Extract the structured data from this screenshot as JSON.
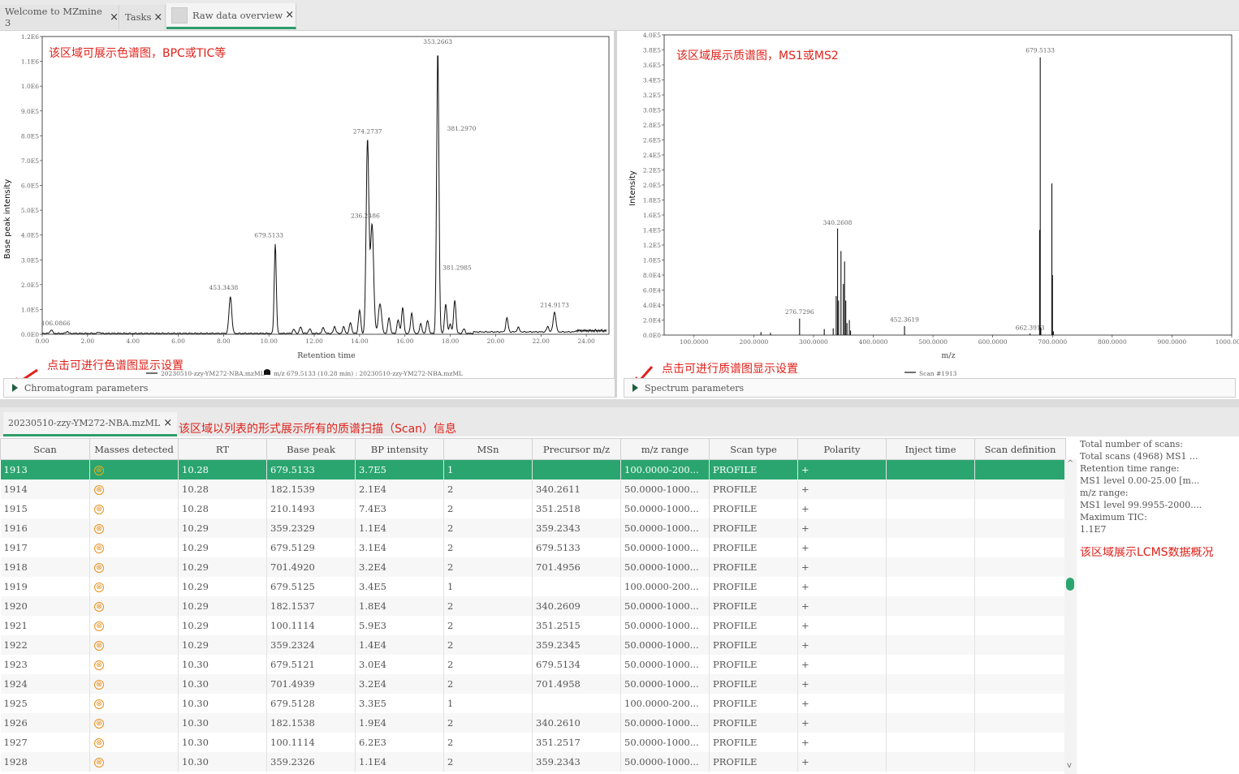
{
  "tabs": [
    {
      "label": "Welcome to MZmine 3",
      "close": "×"
    },
    {
      "label": "Tasks",
      "close": "×"
    },
    {
      "label": "Raw data overview",
      "close": "×"
    }
  ],
  "chromatogram": {
    "annotation": "该区域可展示色谱图，BPC或TIC等",
    "settings_annotation": "点击可进行色谱图显示设置",
    "ylabel": "Base peak intensity",
    "xlabel": "Retention time",
    "legend": "20230510-zzy-YM272-NBA.mzML",
    "legend_marker_text": "m/z 679.5133 (10.28 min) : 20230510-zzy-YM272-NBA.mzML",
    "params_label": "Chromatogram parameters",
    "xticks": [
      "0.00",
      "2.00",
      "4.00",
      "6.00",
      "8.00",
      "10.00",
      "12.00",
      "14.00",
      "16.00",
      "18.00",
      "20.00",
      "22.00",
      "24.00"
    ],
    "yticks": [
      "0.0E0",
      "1.0E5",
      "2.0E5",
      "3.0E5",
      "4.0E5",
      "5.0E5",
      "6.0E5",
      "7.0E5",
      "8.0E5",
      "9.0E5",
      "1.0E6",
      "1.1E6",
      "1.2E6"
    ],
    "peak_labels": [
      "106.0866",
      "453.3438",
      "679.5133",
      "274.2737",
      "236.2486",
      "353.2663",
      "381.2970",
      "381.2985",
      "214.9173"
    ]
  },
  "spectrum": {
    "annotation": "该区域展示质谱图，MS1或MS2",
    "settings_annotation": "点击可进行质谱图显示设置",
    "ylabel": "Intensity",
    "xlabel": "m/z",
    "legend": "Scan #1913",
    "params_label": "Spectrum parameters",
    "xticks": [
      "100.0000",
      "200.0000",
      "300.0000",
      "400.0000",
      "500.0000",
      "600.0000",
      "700.0000",
      "800.0000",
      "900.0000",
      "1000.0000"
    ],
    "yticks": [
      "0.0E0",
      "2.0E4",
      "4.0E4",
      "6.0E4",
      "8.0E4",
      "1.0E5",
      "1.2E5",
      "1.4E5",
      "1.6E5",
      "1.8E5",
      "2.0E5",
      "2.2E5",
      "2.4E5",
      "2.6E5",
      "2.8E5",
      "3.0E5",
      "3.2E5",
      "3.4E5",
      "3.6E5",
      "3.8E5",
      "4.0E5"
    ],
    "peak_labels": [
      "679.5133",
      "340.2608",
      "276.7296",
      "452.3619",
      "662.3913"
    ]
  },
  "file_tab": {
    "label": "20230510-zzy-YM272-NBA.mzML",
    "close": "×"
  },
  "table_annotation": "该区域以列表的形式展示所有的质谱扫描（Scan）信息",
  "table": {
    "headers": [
      "Scan",
      "Masses detected",
      "RT",
      "Base peak",
      "BP intensity",
      "MSn",
      "Precursor m/z",
      "m/z range",
      "Scan type",
      "Polarity",
      "Inject time",
      "Scan definition"
    ],
    "masses_icon": "⊗",
    "rows": [
      [
        "1913",
        "10.28",
        "679.5133",
        "3.7E5",
        "1",
        "",
        "100.0000-200...",
        "PROFILE",
        "+"
      ],
      [
        "1914",
        "10.28",
        "182.1539",
        "2.1E4",
        "2",
        "340.2611",
        "50.0000-1000...",
        "PROFILE",
        "+"
      ],
      [
        "1915",
        "10.28",
        "210.1493",
        "7.4E3",
        "2",
        "351.2518",
        "50.0000-1000...",
        "PROFILE",
        "+"
      ],
      [
        "1916",
        "10.29",
        "359.2329",
        "1.1E4",
        "2",
        "359.2343",
        "50.0000-1000...",
        "PROFILE",
        "+"
      ],
      [
        "1917",
        "10.29",
        "679.5129",
        "3.1E4",
        "2",
        "679.5133",
        "50.0000-1000...",
        "PROFILE",
        "+"
      ],
      [
        "1918",
        "10.29",
        "701.4920",
        "3.2E4",
        "2",
        "701.4956",
        "50.0000-1000...",
        "PROFILE",
        "+"
      ],
      [
        "1919",
        "10.29",
        "679.5125",
        "3.4E5",
        "1",
        "",
        "100.0000-200...",
        "PROFILE",
        "+"
      ],
      [
        "1920",
        "10.29",
        "182.1537",
        "1.8E4",
        "2",
        "340.2609",
        "50.0000-1000...",
        "PROFILE",
        "+"
      ],
      [
        "1921",
        "10.29",
        "100.1114",
        "5.9E3",
        "2",
        "351.2515",
        "50.0000-1000...",
        "PROFILE",
        "+"
      ],
      [
        "1922",
        "10.29",
        "359.2324",
        "1.4E4",
        "2",
        "359.2345",
        "50.0000-1000...",
        "PROFILE",
        "+"
      ],
      [
        "1923",
        "10.30",
        "679.5121",
        "3.0E4",
        "2",
        "679.5134",
        "50.0000-1000...",
        "PROFILE",
        "+"
      ],
      [
        "1924",
        "10.30",
        "701.4939",
        "3.2E4",
        "2",
        "701.4958",
        "50.0000-1000...",
        "PROFILE",
        "+"
      ],
      [
        "1925",
        "10.30",
        "679.5128",
        "3.3E5",
        "1",
        "",
        "100.0000-200...",
        "PROFILE",
        "+"
      ],
      [
        "1926",
        "10.30",
        "182.1538",
        "1.9E4",
        "2",
        "340.2610",
        "50.0000-1000...",
        "PROFILE",
        "+"
      ],
      [
        "1927",
        "10.30",
        "100.1114",
        "6.2E3",
        "2",
        "351.2517",
        "50.0000-1000...",
        "PROFILE",
        "+"
      ],
      [
        "1928",
        "10.30",
        "359.2326",
        "1.1E4",
        "2",
        "359.2343",
        "50.0000-1000...",
        "PROFILE",
        "+"
      ]
    ]
  },
  "summary": {
    "lines": [
      "Total number of scans:",
      "Total scans (4968) MS1 ...",
      "Retention time range:",
      "MS1 level 0.00-25.00 [m...",
      "m/z range:",
      "MS1 level 99.9955-2000....",
      "Maximum TIC:",
      "1.1E7"
    ],
    "annotation": "该区域展示LCMS数据概况"
  },
  "scroll": {
    "up": "^",
    "down": "v"
  },
  "colors": {
    "accent": "#2aa56f",
    "annotation": "#e0211a",
    "masses_icon": "#e8911e"
  }
}
